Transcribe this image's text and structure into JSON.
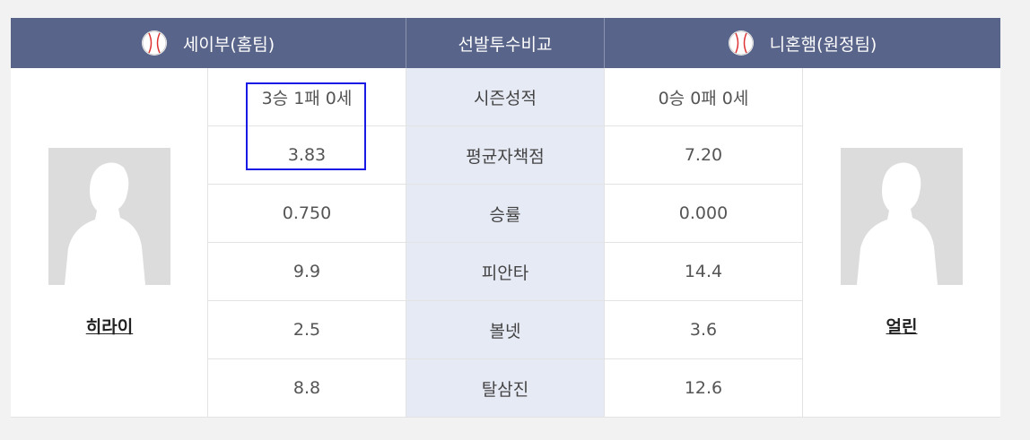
{
  "header": {
    "home_team": "세이부(홈팀)",
    "compare_title": "선발투수비교",
    "away_team": "니혼햄(원정팀)"
  },
  "home_pitcher": {
    "name": "히라이",
    "photo_icon": "person-silhouette-icon"
  },
  "away_pitcher": {
    "name": "얼린",
    "photo_icon": "person-silhouette-icon"
  },
  "rows": [
    {
      "label": "시즌성적",
      "home": "3승 1패 0세",
      "away": "0승 0패 0세"
    },
    {
      "label": "평균자책점",
      "home": "3.83",
      "away": "7.20"
    },
    {
      "label": "승률",
      "home": "0.750",
      "away": "0.000"
    },
    {
      "label": "피안타",
      "home": "9.9",
      "away": "14.4"
    },
    {
      "label": "볼넷",
      "home": "2.5",
      "away": "3.6"
    },
    {
      "label": "탈삼진",
      "home": "8.8",
      "away": "12.6"
    }
  ],
  "colors": {
    "header_bg": "#586489",
    "middle_bg": "#e6eaf5",
    "highlight_border": "#1a1ae6"
  }
}
